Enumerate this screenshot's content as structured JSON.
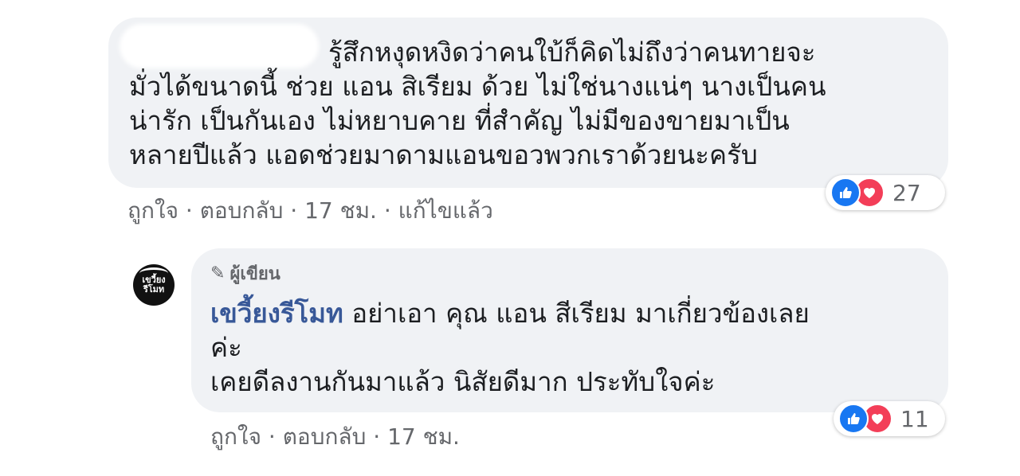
{
  "comments": [
    {
      "lines": [
        "รู้สึกหงุดหงิดว่าคนใบ้ก็คิดไม่ถึงว่าคนทายจะ",
        "มั่วได้ขนาดนี้ ช่วย แอน สิเรียม ด้วย ไม่ใช่นางแน่ๆ นางเป็นคน",
        "น่ารัก เป็นกันเอง ไม่หยาบคาย ที่สำคัญ ไม่มีของขายมาเป็น",
        "หลายปีแล้ว แอดช่วยมาดามแอนขอวพวกเราด้วยนะครับ"
      ],
      "reactions_count": "27",
      "meta": {
        "like": "ถูกใจ",
        "sep": " · ",
        "reply": "ตอบกลับ",
        "time": "17 ชม.",
        "edited": "แก้ไขแล้ว"
      }
    },
    {
      "badge": "ผู้เขียน",
      "author": "เขวี้ยงรีโมท",
      "line0_rest": " อย่าเอา คุณ แอน สีเรียม มาเกี่ยวข้องเลย",
      "line1": "ค่ะ",
      "line2": "เคยดีลงานกันมาแล้ว นิสัยดีมาก ประทับใจค่ะ",
      "avatar_text": [
        "เขวี้ยง",
        "รีโมท"
      ],
      "reactions_count": "11",
      "meta": {
        "like": "ถูกใจ",
        "sep": " · ",
        "reply": "ตอบกลับ",
        "time": "17 ชม."
      }
    }
  ],
  "colors": {
    "bubble": "#f0f2f5",
    "author": "#385898",
    "meta": "#65676b",
    "like": "#1877f2",
    "love": "#f33e58"
  }
}
